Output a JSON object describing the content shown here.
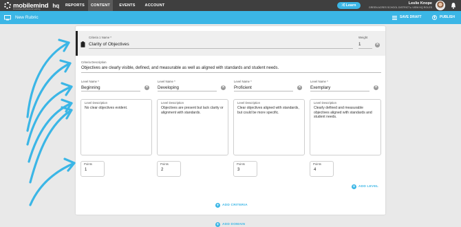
{
  "nav": {
    "logo_text": "mobilemind",
    "logo_subtitle": "Personalized Professional Learning",
    "hq": "hq",
    "items": [
      {
        "label": "REPORTS",
        "active": false
      },
      {
        "label": "CONTENT",
        "active": true
      },
      {
        "label": "EVENTS",
        "active": false
      },
      {
        "label": "ACCOUNT",
        "active": false
      }
    ],
    "learn_label": "Learn",
    "user_name": "Leslie Knope",
    "user_org": "GREEN ACRES SCHOOL DISTRICT  ▸  VIEW HQ ROLES"
  },
  "subheader": {
    "title": "New Rubric",
    "save_label": "SAVE DRAFT",
    "publish_label": "PUBLISH"
  },
  "criteria": {
    "name_label": "Criteria 1 Name *",
    "name_value": "Clarity of Objectives",
    "weight_label": "Weight",
    "weight_value": "1",
    "description_label": "Criteria Description",
    "description_value": "Objectives are clearly visible, defined, and measurable as well as aligned with standards and student needs.",
    "levels": [
      {
        "name_label": "Level Name *",
        "name": "Beginning",
        "desc_label": "Level Description",
        "desc": "No clear objectives evident.",
        "points_label": "Points",
        "points": "1"
      },
      {
        "name_label": "Level Name *",
        "name": "Developing",
        "desc_label": "Level Description",
        "desc": "Objectives are present but lack clarity or alignment with standards.",
        "points_label": "Points",
        "points": "2"
      },
      {
        "name_label": "Level Name *",
        "name": "Proficient",
        "desc_label": "Level Description",
        "desc": "Clear objectives aligned with standards, but could be more specific.",
        "points_label": "Points",
        "points": "3"
      },
      {
        "name_label": "Level Name *",
        "name": "Exemplary",
        "desc_label": "Level Description",
        "desc": "Clearly defined and measurable objectives aligned with standards and student needs.",
        "points_label": "Points",
        "points": "4"
      }
    ],
    "add_level_label": "ADD LEVEL",
    "add_criteria_label": "ADD CRITERIA"
  },
  "add_domain_label": "ADD DOMAIN",
  "colors": {
    "accent": "#3bb6e6",
    "nav_bg": "#3f3f3f",
    "annotation_arrow": "#3bb6e6"
  }
}
